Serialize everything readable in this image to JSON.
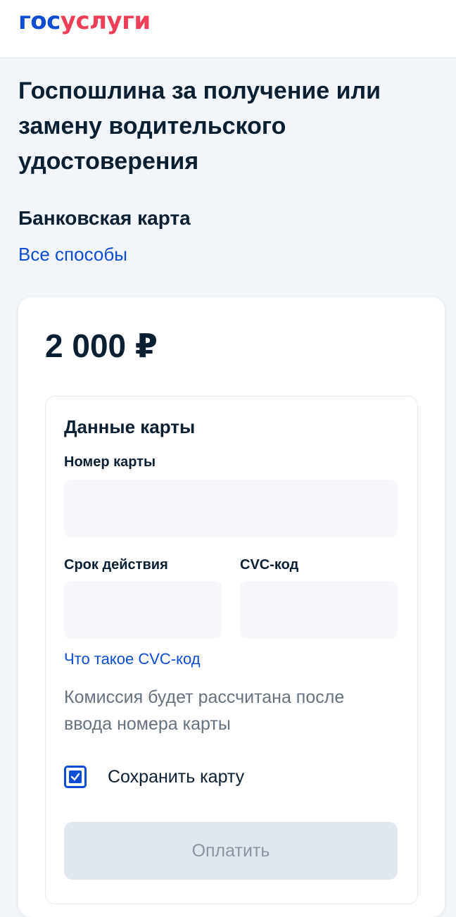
{
  "header": {
    "logo_part1": "гос",
    "logo_part2": "услуги"
  },
  "page": {
    "title": "Госпошлина за получение или замену водительского удостоверения",
    "method_title": "Банковская карта",
    "all_methods_link": "Все способы"
  },
  "payment": {
    "amount": "2 000 ₽"
  },
  "card_form": {
    "section_title": "Данные карты",
    "card_number_label": "Номер карты",
    "card_number_value": "",
    "expiry_label": "Срок действия",
    "expiry_value": "",
    "cvc_label": "CVC-код",
    "cvc_value": "",
    "cvc_help_link": "Что такое CVC-код",
    "commission_note": "Комиссия будет рассчитана после ввода номера карты",
    "save_card_label": "Сохранить карту",
    "save_card_checked": true,
    "pay_button_label": "Оплатить",
    "pay_button_enabled": false
  },
  "colors": {
    "brand_blue": "#0d4cd3",
    "brand_red": "#ee3f58",
    "background": "#f2f6fa",
    "text": "#0b1f33"
  }
}
